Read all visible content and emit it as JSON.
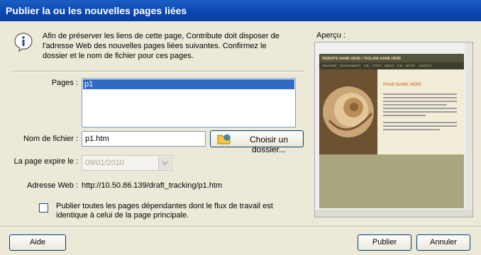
{
  "window": {
    "title": "Publier la ou les nouvelles pages liées"
  },
  "info": {
    "text": "Afin de préserver les liens de cette page, Contribute doit disposer de l'adresse Web des nouvelles pages liées suivantes. Confirmez le dossier et le nom de fichier pour ces pages."
  },
  "pages": {
    "label": "Pages :",
    "items": [
      "p1"
    ]
  },
  "filename": {
    "label": "Nom de fichier :",
    "value": "p1.htm",
    "choose_folder_label": "Choisir un dossier..."
  },
  "expire": {
    "label": "La page expire le :",
    "value": "09/01/2010"
  },
  "web_address": {
    "label": "Adresse Web :",
    "value": "http://10.50.86.139/draft_tracking/p1.htm"
  },
  "publish_all": {
    "label": "Publier toutes les pages dépendantes dont le flux de travail est identique à celui de la page principale.",
    "checked": false
  },
  "preview": {
    "label": "Aperçu :",
    "site_header": "WEBSITE NAME HERE | TAGLINE NAME HERE",
    "nav_items": [
      "WELCOME",
      "ENVIRONMENT",
      "THE STORY",
      "ABOUT THE ARTIST",
      "CONTACT"
    ],
    "page_title": "PAGE NAME HERE"
  },
  "buttons": {
    "help": "Aide",
    "publish": "Publier",
    "cancel": "Annuler"
  }
}
